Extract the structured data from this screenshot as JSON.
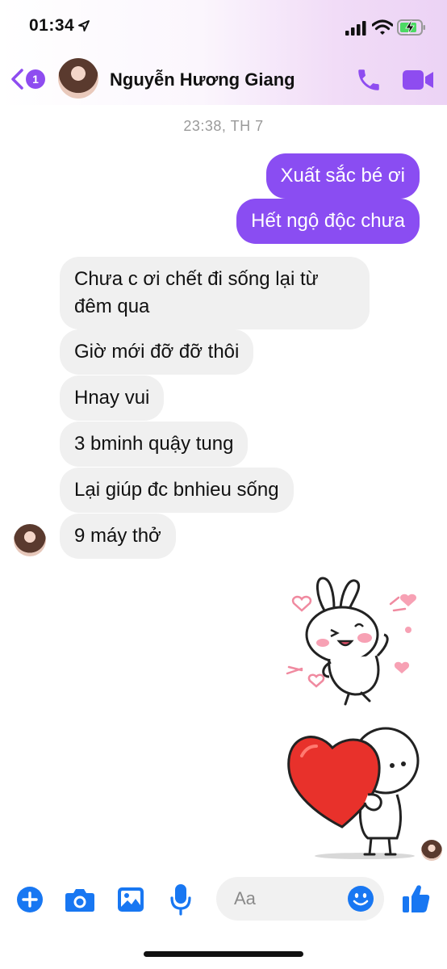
{
  "status_bar": {
    "time": "01:34"
  },
  "header": {
    "back_badge": "1",
    "contact_name": "Nguyễn Hương Giang",
    "icons": [
      "back-chevron-icon",
      "phone-icon",
      "video-camera-icon"
    ]
  },
  "conversation": {
    "timestamp": "23:38, TH 7",
    "sent_messages": [
      {
        "text": "Xuất sắc bé ơi"
      },
      {
        "text": "Hết ngộ độc chưa"
      }
    ],
    "received_messages": [
      {
        "text": "Chưa c ơi chết đi sống lại từ đêm qua"
      },
      {
        "text": "Giờ mới đỡ đỡ thôi"
      },
      {
        "text": "Hnay vui"
      },
      {
        "text": "3 bminh quậy tung"
      },
      {
        "text": "Lại giúp đc bnhieu sống"
      },
      {
        "text": "9 máy thở"
      }
    ],
    "stickers": [
      "bunny-sticker",
      "heart-hug-sticker"
    ]
  },
  "composer": {
    "placeholder": "Aa",
    "icons": [
      "plus-icon",
      "camera-icon",
      "gallery-icon",
      "microphone-icon",
      "emoji-icon",
      "thumbs-up-icon"
    ]
  },
  "colors": {
    "accent": "#8a4df2",
    "received_bubble": "#f0f0f0",
    "composer_icon": "#1877f2"
  }
}
